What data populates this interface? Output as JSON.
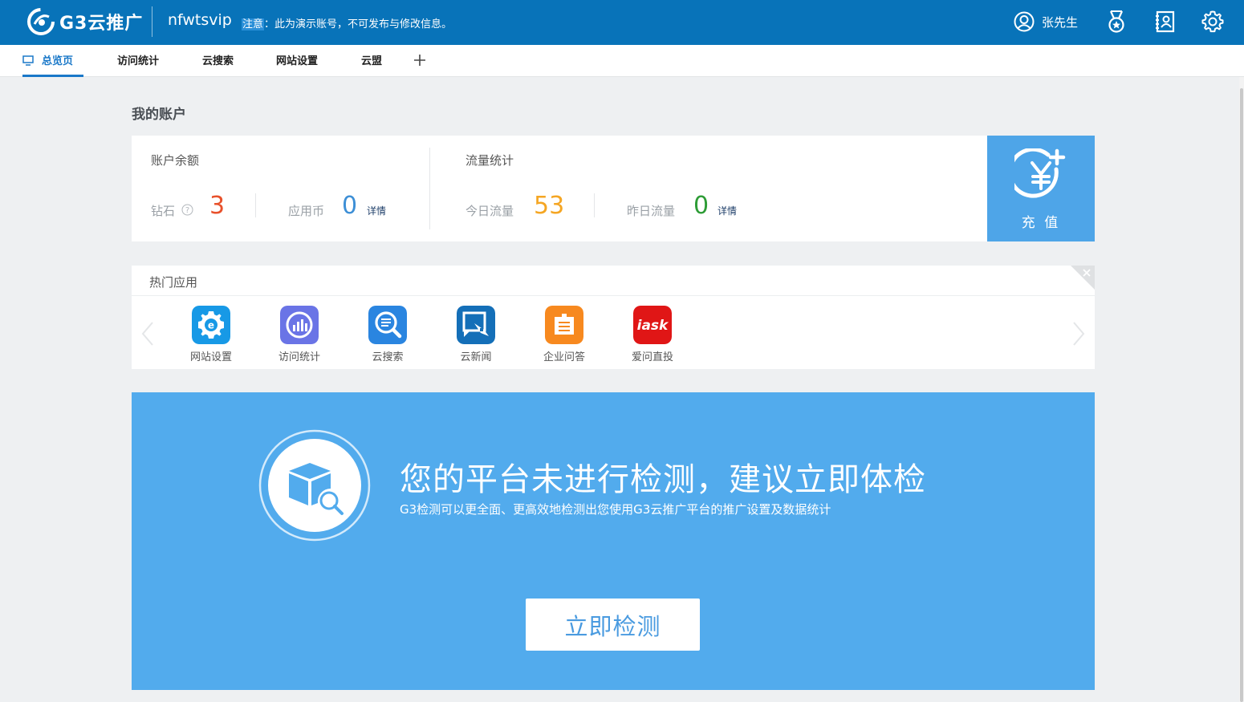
{
  "header": {
    "logo_text": "G3云推广",
    "account": "nfwtsvip",
    "notice_highlight": "注意",
    "notice_rest": "：此为演示账号，不可发布与修改信息。",
    "user_name": "张先生",
    "icons": [
      "user-icon",
      "medal-icon",
      "contacts-icon",
      "gear-icon"
    ]
  },
  "tabs": [
    {
      "label": "总览页",
      "active": true
    },
    {
      "label": "访问统计"
    },
    {
      "label": "云搜索"
    },
    {
      "label": "网站设置"
    },
    {
      "label": "云盟"
    }
  ],
  "account_section": {
    "title": "我的账户",
    "balance": {
      "label": "账户余额",
      "diamond_label": "钻石",
      "diamond_value": "3",
      "coin_label": "应用币",
      "coin_value": "0",
      "detail": "详情"
    },
    "traffic": {
      "label": "流量统计",
      "today_label": "今日流量",
      "today_value": "53",
      "yesterday_label": "昨日流量",
      "yesterday_value": "0",
      "detail": "详情"
    },
    "recharge_label": "充 值"
  },
  "hot_apps": {
    "title": "热门应用",
    "items": [
      {
        "name": "网站设置",
        "icon": "website-settings-icon"
      },
      {
        "name": "访问统计",
        "icon": "visit-stats-icon"
      },
      {
        "name": "云搜索",
        "icon": "cloud-search-icon"
      },
      {
        "name": "云新闻",
        "icon": "cloud-news-icon"
      },
      {
        "name": "企业问答",
        "icon": "enterprise-qa-icon"
      },
      {
        "name": "爱问直投",
        "icon": "iask-icon"
      }
    ]
  },
  "banner": {
    "title": "您的平台未进行检测，建议立即体检",
    "subtitle": "G3检测可以更全面、更高效地检测出您使用G3云推广平台的推广设置及数据统计",
    "button": "立即检测"
  },
  "colors": {
    "header_bg": "#0873b9",
    "accent": "#1a78c8",
    "banner_bg": "#52abed",
    "diamond": "#e8512b",
    "coin": "#3d8fd6",
    "today": "#f5a623",
    "yesterday": "#2e9c36"
  }
}
